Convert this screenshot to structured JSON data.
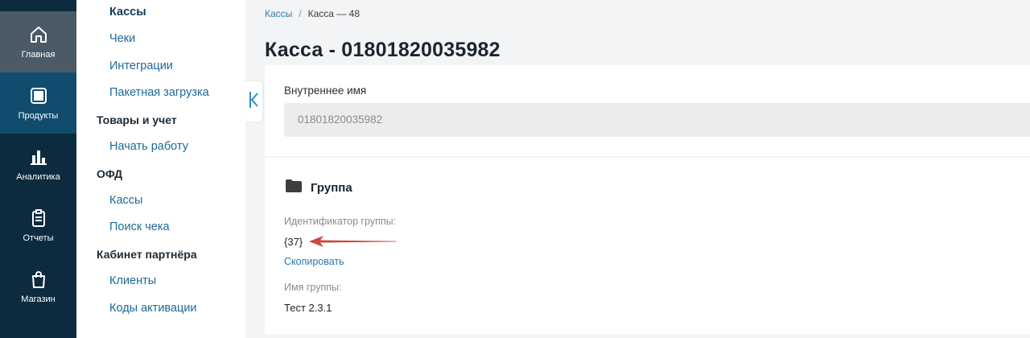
{
  "rail": {
    "items": [
      {
        "label": "Главная",
        "icon": "home-icon"
      },
      {
        "label": "Продукты",
        "icon": "grid-icon"
      },
      {
        "label": "Аналитика",
        "icon": "bar-chart-icon"
      },
      {
        "label": "Отчеты",
        "icon": "clipboard-icon"
      },
      {
        "label": "Магазин",
        "icon": "shopping-bag-icon"
      }
    ]
  },
  "subnav": {
    "items": [
      {
        "label": "Кассы"
      },
      {
        "label": "Чеки"
      },
      {
        "label": "Интеграции"
      },
      {
        "label": "Пакетная загрузка"
      },
      {
        "label": "Товары и учет"
      },
      {
        "label": "Начать работу"
      },
      {
        "label": "ОФД"
      },
      {
        "label": "Кассы"
      },
      {
        "label": "Поиск чека"
      },
      {
        "label": "Кабинет партнёра"
      },
      {
        "label": "Клиенты"
      },
      {
        "label": "Коды активации"
      }
    ]
  },
  "breadcrumb": {
    "parent": "Кассы",
    "separator": "/",
    "current": "Касса — 48"
  },
  "page": {
    "title": "Касса - 01801820035982"
  },
  "internal_name": {
    "label": "Внутреннее имя",
    "value": "01801820035982"
  },
  "group": {
    "title": "Группа",
    "id_label": "Идентификатор группы:",
    "id_value": "{37}",
    "copy_label": "Скопировать",
    "name_label": "Имя группы:",
    "name_value": "Тест 2.3.1"
  },
  "colors": {
    "rail_bg": "#0d2b3e",
    "accent_link": "#2a7ab0",
    "annotation_arrow": "#c9483b"
  }
}
